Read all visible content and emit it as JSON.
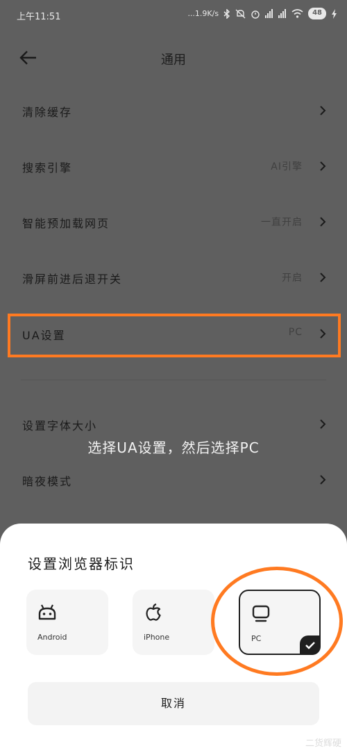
{
  "status_bar": {
    "time": "上午11:51",
    "net_speed": "...1.9K/s",
    "battery": "48"
  },
  "header": {
    "title": "通用"
  },
  "settings": [
    {
      "label": "清除缓存",
      "value": ""
    },
    {
      "label": "搜索引擎",
      "value": "AI引擎"
    },
    {
      "label": "智能预加载网页",
      "value": "一直开启"
    },
    {
      "label": "滑屏前进后退开关",
      "value": "开启"
    },
    {
      "label": "UA设置",
      "value": "PC"
    },
    {
      "label": "设置字体大小",
      "value": ""
    },
    {
      "label": "暗夜模式",
      "value": ""
    }
  ],
  "overlay_annotation": "选择UA设置，然后选择PC",
  "sheet": {
    "title": "设置浏览器标识",
    "options": [
      {
        "label": "Android",
        "icon": "android-icon",
        "selected": false
      },
      {
        "label": "iPhone",
        "icon": "apple-icon",
        "selected": false
      },
      {
        "label": "PC",
        "icon": "monitor-icon",
        "selected": true
      }
    ],
    "cancel_label": "取消"
  },
  "watermark": "二货辉硬",
  "colors": {
    "highlight": "#ff7a21",
    "overlay": "#5f5f5f",
    "sheet": "#ffffff"
  }
}
